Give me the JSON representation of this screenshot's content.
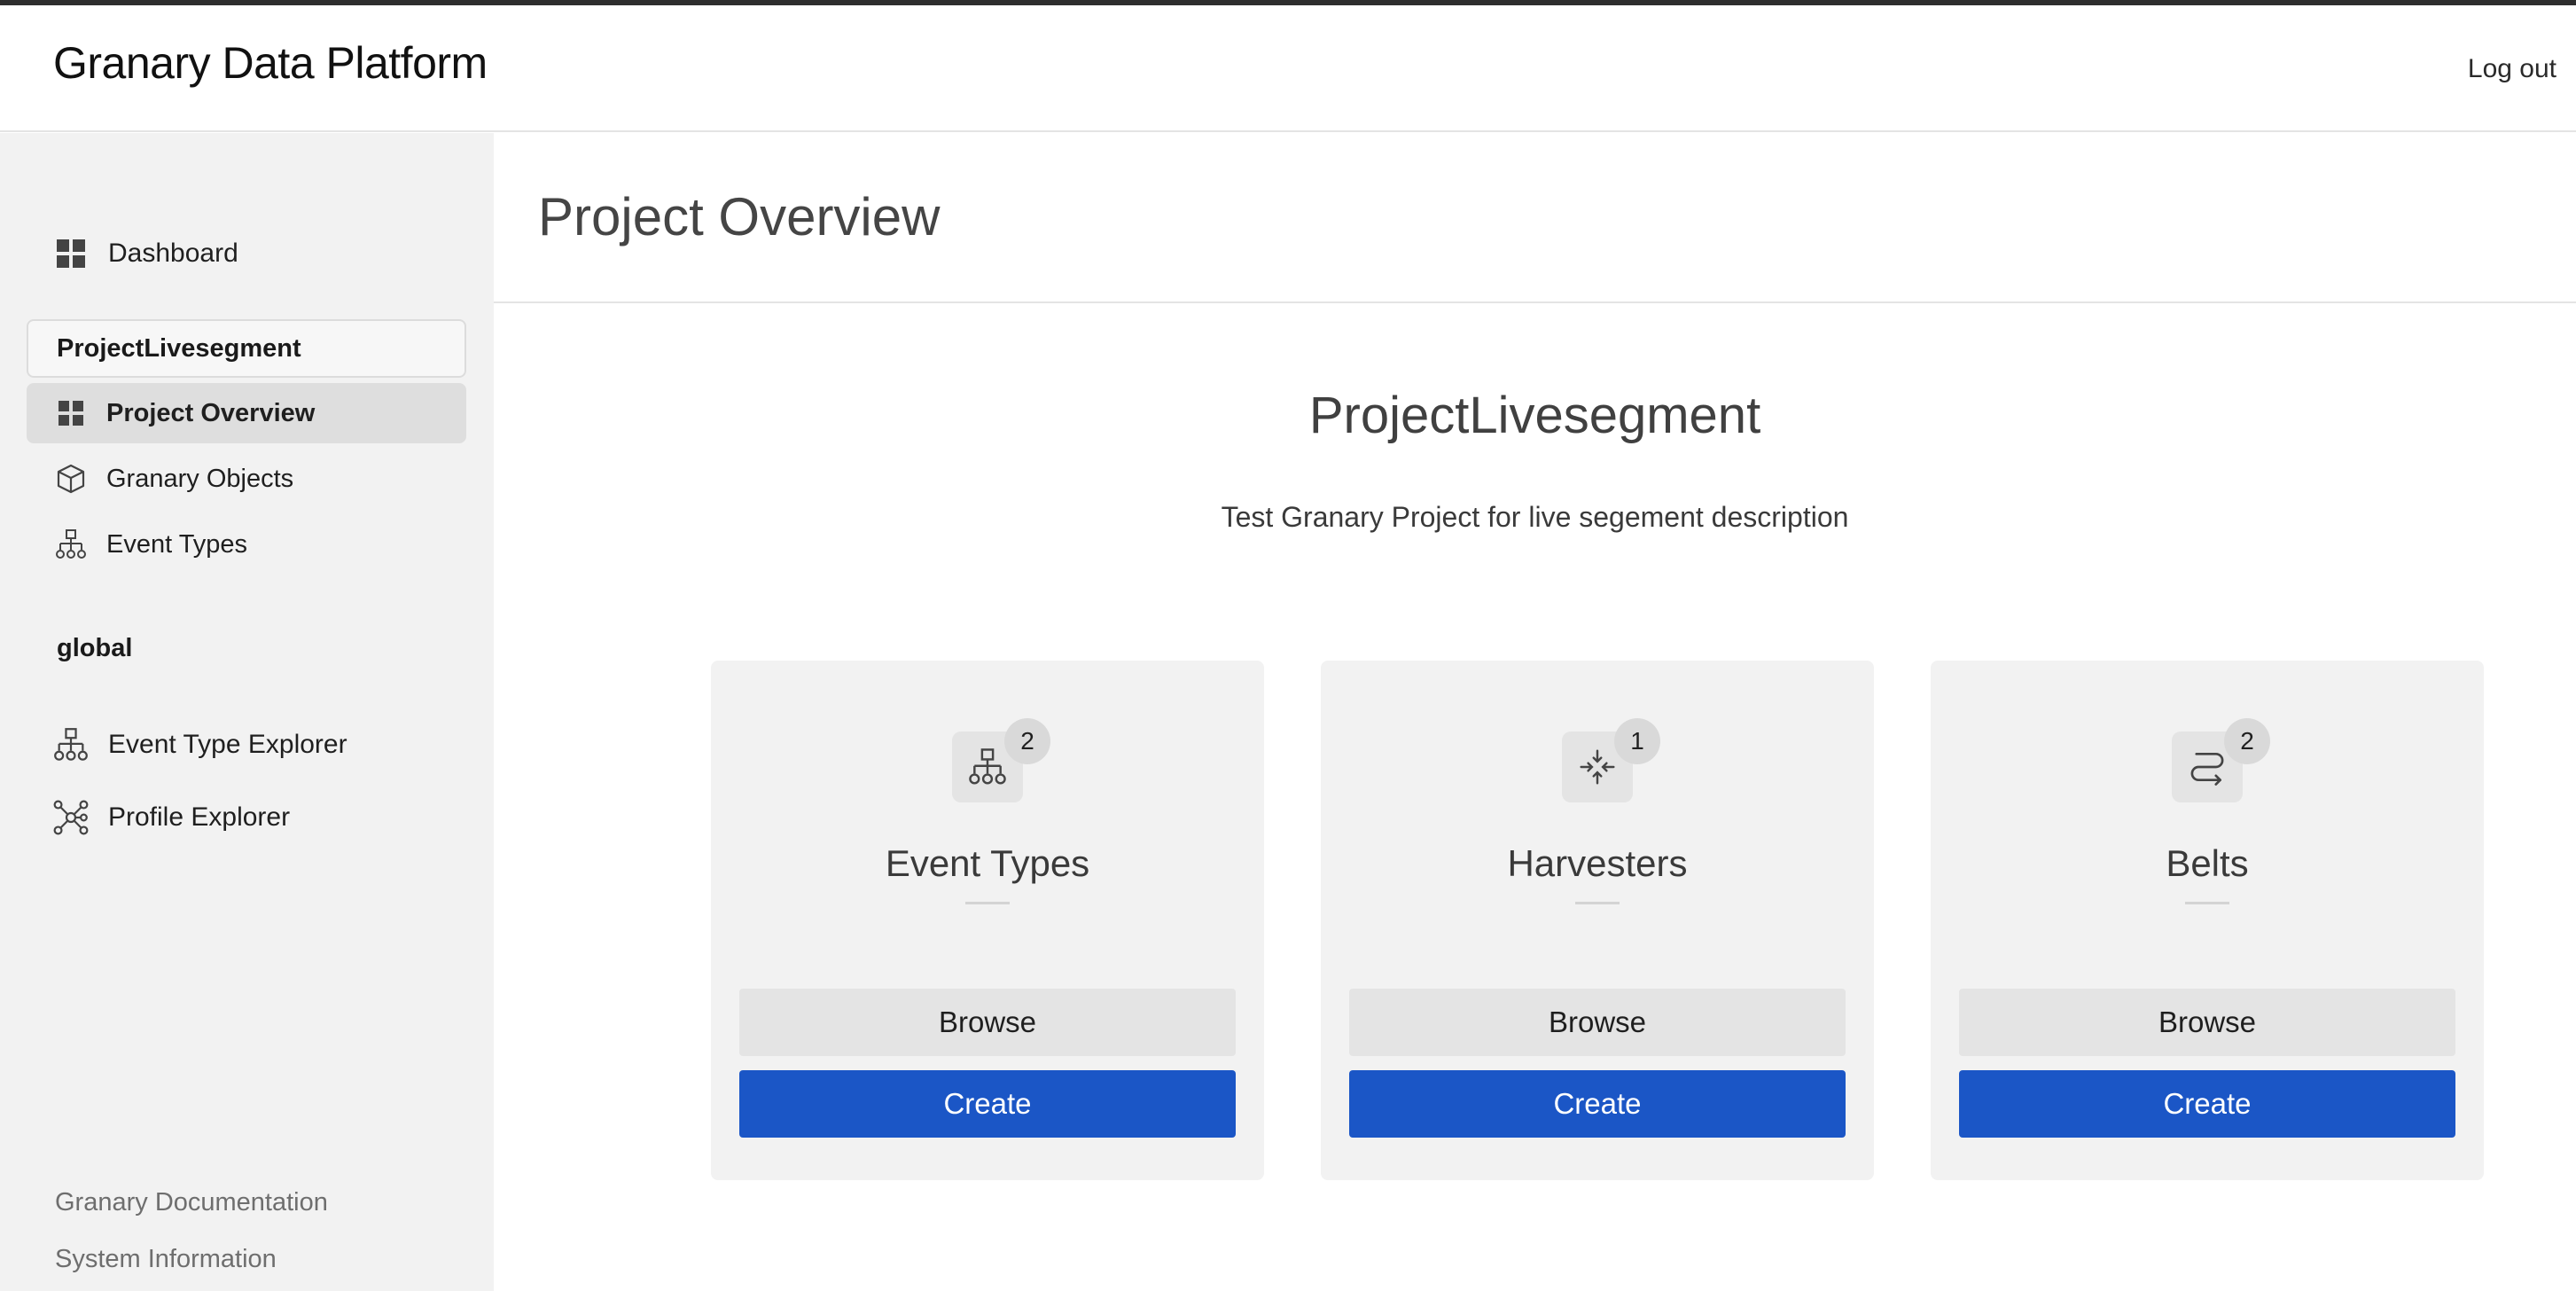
{
  "header": {
    "app_title": "Granary Data Platform",
    "logout_label": "Log out"
  },
  "sidebar": {
    "dashboard_label": "Dashboard",
    "project_name": "ProjectLivesegment",
    "project_items": [
      {
        "label": "Project Overview",
        "icon": "grid-icon",
        "active": true
      },
      {
        "label": "Granary Objects",
        "icon": "cube-icon",
        "active": false
      },
      {
        "label": "Event Types",
        "icon": "hierarchy-icon",
        "active": false
      }
    ],
    "global_label": "global",
    "global_items": [
      {
        "label": "Event Type Explorer",
        "icon": "hierarchy-icon"
      },
      {
        "label": "Profile Explorer",
        "icon": "network-icon"
      }
    ],
    "footer_links": [
      "Granary Documentation",
      "System Information"
    ]
  },
  "main": {
    "page_title": "Project Overview",
    "project_name": "ProjectLivesegment",
    "project_description": "Test Granary Project for live segement description",
    "cards": [
      {
        "title": "Event Types",
        "count": "2",
        "icon": "hierarchy-icon",
        "browse_label": "Browse",
        "create_label": "Create"
      },
      {
        "title": "Harvesters",
        "count": "1",
        "icon": "converge-icon",
        "browse_label": "Browse",
        "create_label": "Create"
      },
      {
        "title": "Belts",
        "count": "2",
        "icon": "route-icon",
        "browse_label": "Browse",
        "create_label": "Create"
      }
    ]
  },
  "colors": {
    "primary": "#1b56c6",
    "sidebar_bg": "#f2f2f2",
    "card_bg": "#f2f2f2",
    "active_item_bg": "#dedede"
  }
}
